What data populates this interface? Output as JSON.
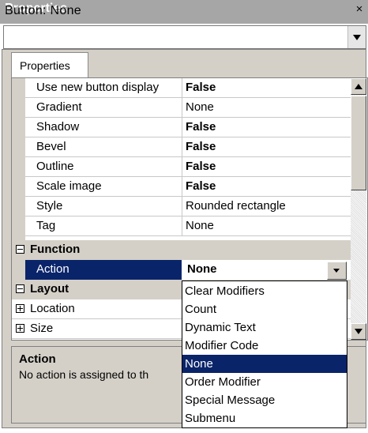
{
  "window": {
    "title": "Properties",
    "close_glyph": "×"
  },
  "object_selector": {
    "value": "Button: None"
  },
  "tabs": [
    {
      "label": "Properties"
    }
  ],
  "grid": {
    "rows": [
      {
        "name": "Use new button display",
        "value": "False",
        "bold": true
      },
      {
        "name": "Gradient",
        "value": "None",
        "bold": false
      },
      {
        "name": "Shadow",
        "value": "False",
        "bold": true
      },
      {
        "name": "Bevel",
        "value": "False",
        "bold": true
      },
      {
        "name": "Outline",
        "value": "False",
        "bold": true
      },
      {
        "name": "Scale image",
        "value": "False",
        "bold": true
      },
      {
        "name": "Style",
        "value": "Rounded rectangle",
        "bold": false
      },
      {
        "name": "Tag",
        "value": "None",
        "bold": false
      }
    ],
    "function_category": {
      "label": "Function",
      "expanded": true
    },
    "action_row": {
      "name": "Action",
      "value": "None"
    },
    "layout_category": {
      "label": "Layout",
      "expanded": true
    },
    "layout_rows": [
      {
        "name": "Location",
        "collapsed": true
      },
      {
        "name": "Size",
        "collapsed": true
      }
    ]
  },
  "dropdown": {
    "options": [
      "Clear Modifiers",
      "Count",
      "Dynamic Text",
      "Modifier Code",
      "None",
      "Order Modifier",
      "Special Message",
      "Submenu"
    ],
    "selected": "None"
  },
  "description": {
    "title": "Action",
    "text": "No action is assigned to th"
  },
  "colors": {
    "selection": "#0a246a",
    "panel": "#d4d0c8",
    "titlebar": "#a6a6a6"
  }
}
